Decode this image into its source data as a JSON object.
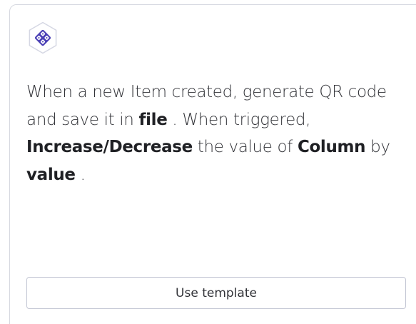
{
  "app_icon": {
    "name": "qr-code-app-icon",
    "badge_border_color": "#d5d7e3",
    "icon_color": "#4a3fb5"
  },
  "description": {
    "text_before_file": "When a new Item created, generate QR code and save it in ",
    "file_token": "file",
    "text_after_file": " . When triggered, ",
    "action_token": "Increase/Decrease",
    "text_after_action": " the value of ",
    "column_token": "Column",
    "text_after_column": " by ",
    "value_token": "value",
    "text_end": " ."
  },
  "actions": {
    "use_template_label": "Use template"
  }
}
